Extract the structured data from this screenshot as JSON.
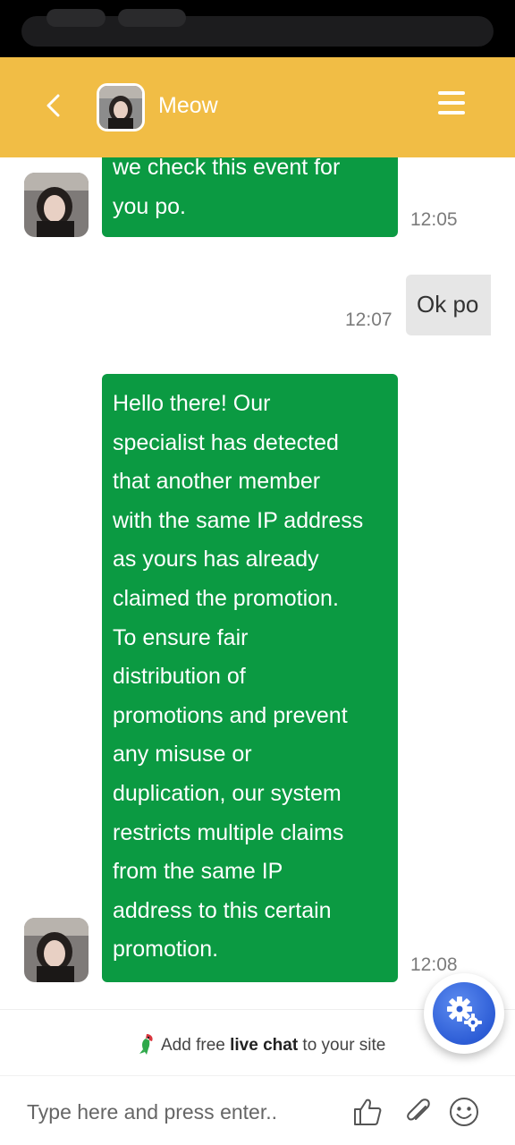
{
  "header": {
    "agent_name": "Meow"
  },
  "messages": [
    {
      "sender": "agent",
      "lines": [
        "we check this event for",
        "you po."
      ],
      "time": "12:05"
    },
    {
      "sender": "user",
      "text": "Ok po",
      "time": "12:07"
    },
    {
      "sender": "agent",
      "lines": [
        "Hello there! Our",
        "specialist has detected",
        "that another member",
        "with the same IP address",
        "as yours has already",
        "claimed the promotion.",
        "To ensure fair",
        "distribution of",
        "promotions and prevent",
        "any misuse or",
        "duplication, our system",
        "restricts multiple claims",
        "from the same IP",
        "address to this certain",
        "promotion."
      ],
      "time": "12:08"
    }
  ],
  "branding": {
    "prefix": "Add free ",
    "bold": "live chat",
    "suffix": " to your site"
  },
  "input": {
    "placeholder": "Type here and press enter.."
  },
  "icons": {
    "back": "chevron-left-icon",
    "menu": "hamburger-menu-icon",
    "like": "thumbs-up-icon",
    "attach": "paperclip-icon",
    "emoji": "smiley-icon",
    "settings": "gears-icon",
    "brand": "parrot-icon"
  },
  "colors": {
    "header": "#f1bd45",
    "agent_bubble": "#0b9a42",
    "user_bubble": "#e6e6e6",
    "fab": "#2d5dd6"
  }
}
